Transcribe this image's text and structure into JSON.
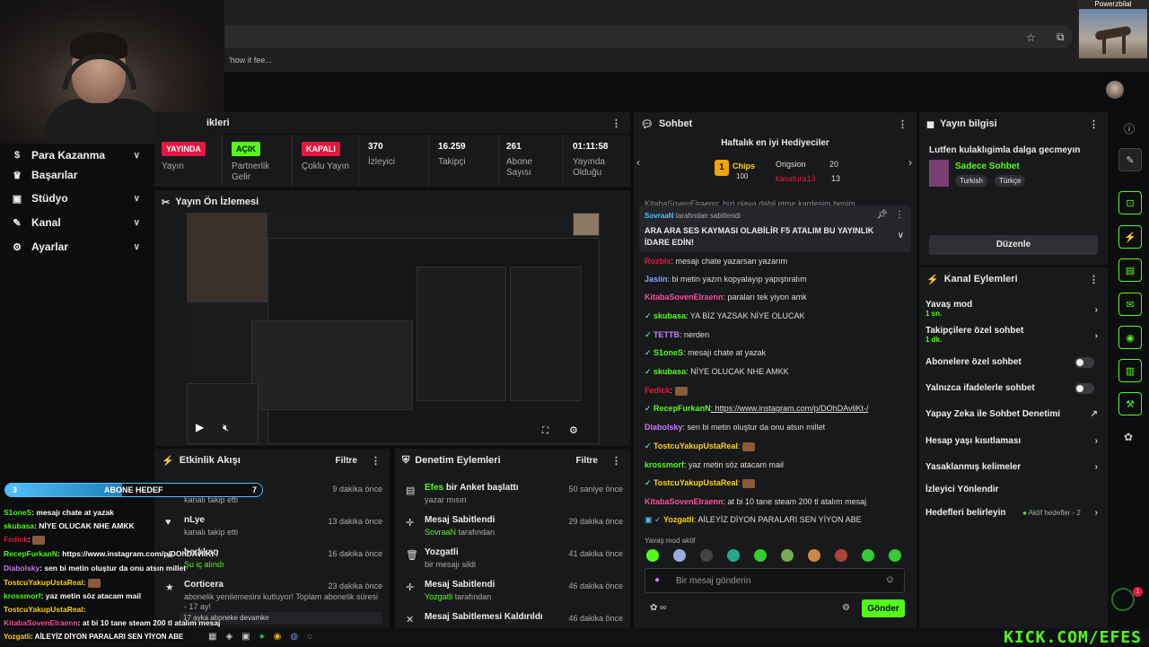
{
  "browser": {
    "bookmark": "'how it fee..."
  },
  "pip": {
    "label": "Powerzbilal"
  },
  "sidenav": [
    {
      "label": "Para Kazanma",
      "icon": "dollar-icon",
      "chev": "∨"
    },
    {
      "label": "Başarılar",
      "icon": "trophy-icon",
      "chev": ""
    },
    {
      "label": "Stüdyo",
      "icon": "studio-icon",
      "chev": "∨"
    },
    {
      "label": "Kanal",
      "icon": "channel-icon",
      "chev": "∨"
    },
    {
      "label": "Ayarlar",
      "icon": "gear-icon",
      "chev": "∨"
    }
  ],
  "stats_header": "ikleri",
  "stats": [
    {
      "value": "YAYINDA",
      "label": "Yayın"
    },
    {
      "value": "AÇIK",
      "label": "Partnerlik Gelir"
    },
    {
      "value": "KAPALI",
      "label": "Çoklu Yayın"
    },
    {
      "value": "370",
      "label": "İzleyici"
    },
    {
      "value": "16.259",
      "label": "Takipçi"
    },
    {
      "value": "261",
      "label": "Abone Sayısı"
    },
    {
      "value": "01:11:58",
      "label": "Yayında Olduğu"
    }
  ],
  "preview": {
    "title": "Yayın Ön İzlemesi"
  },
  "events": {
    "title": "Etkinlik Akışı",
    "filter": "Filtre",
    "items": [
      {
        "name": "alierenmingsaer",
        "desc": "kanalı takip etti",
        "time": "9 dakika önce"
      },
      {
        "name": "nLye",
        "desc": "kanalı takip etti",
        "time": "13 dakika önce"
      },
      {
        "name": "berkkan",
        "desc": "Şu iç alındı",
        "time": "16 dakika önce"
      },
      {
        "name": "Corticera",
        "desc": "abonelik yenilemesini kutluyor! Toplam abonelik süresi - 17 ay!",
        "time": "23 dakika önce"
      },
      {
        "name": "",
        "desc": "17 ayka aboneke devamke",
        "time": ""
      }
    ]
  },
  "mod": {
    "title": "Denetim Eylemleri",
    "filter": "Filtre",
    "items": [
      {
        "title_user": "Efes",
        "title": " bir Anket başlattı",
        "desc": "yazar mısın",
        "time": "50 saniye önce"
      },
      {
        "title_user": "",
        "title": "Mesaj Sabitlendi",
        "desc_user": "SovraaN",
        "desc": " tarafından",
        "time": "29 dakika önce"
      },
      {
        "title_user": "",
        "title": "Yozgatli",
        "desc": "bir mesajı sildi",
        "time": "41 dakika önce"
      },
      {
        "title_user": "",
        "title": "Mesaj Sabitlendi",
        "desc_user": "Yozgatli",
        "desc": " tarafından",
        "time": "46 dakika önce"
      },
      {
        "title_user": "",
        "title": "Mesaj Sabitlemesi Kaldırıldı",
        "desc": "",
        "time": "46 dakika önce"
      }
    ]
  },
  "chat": {
    "title": "Sohbet",
    "gifters_title": "Haftalık en iyi Hediyeciler",
    "gifters": [
      {
        "rank": "1",
        "name": "Chips",
        "count": "100"
      },
      {
        "name": "Origsion",
        "count": "20"
      },
      {
        "name": "kasatura13",
        "count": "13"
      }
    ],
    "partial_line": "KitabaSovenElraenn: bizi olaya dahil etme kardeşim benim",
    "pinned_by": "SovraaN",
    "pinned_by_suffix": "tarafından sabitlendi",
    "pinned_text": "ARA ARA SES KAYMASI OLABİLİR F5 ATALIM BU YAYINLIK İDARE EDİN!",
    "messages": [
      {
        "user": "Rozbis",
        "color": "#e5173f",
        "text": ": mesajı chate yazarsan yazarım"
      },
      {
        "user": "Jasiin",
        "color": "#7fa7ff",
        "text": ": bi metin yazın kopyalayıp yapıştıralım"
      },
      {
        "user": "KitabaSovenElraenn",
        "color": "#ff4d9a",
        "text": ": paraları tek yiyon amk"
      },
      {
        "user": "skubasa",
        "color": "#53fc18",
        "text": ": YA BİZ YAZSAK NİYE OLUCAK"
      },
      {
        "user": "TETTB",
        "color": "#c77dff",
        "text": ": nerden"
      },
      {
        "user": "S1oneS",
        "color": "#53fc18",
        "text": ": mesajı chate at yazak"
      },
      {
        "user": "skubasa",
        "color": "#53fc18",
        "text": ": NİYE OLUCAK NHE AMKK"
      },
      {
        "user": "Fedick",
        "color": "#e5173f",
        "text": ":"
      },
      {
        "user": "RecepFurkanN",
        "color": "#53fc18",
        "text": ": https://www.instagram.com/p/DOhDAvliKt-/"
      },
      {
        "user": "Diabolsky",
        "color": "#c77dff",
        "text": ": sen bi metin oluştur da onu atsın millet"
      },
      {
        "user": "TostcuYakupUstaReal",
        "color": "#ffd400",
        "text": ":"
      },
      {
        "user": "krossmorf",
        "color": "#53fc18",
        "text": ": yaz metin söz atacam mail"
      },
      {
        "user": "TostcuYakupUstaReal",
        "color": "#ffd400",
        "text": ":"
      },
      {
        "user": "KitabaSovenElraenn",
        "color": "#ff4d9a",
        "text": ": at bi 10 tane steam 200 tl atalım mesaj"
      },
      {
        "user": "Yozgatli",
        "color": "#ffd400",
        "text": ": AİLEYİZ DİYON PARALARI SEN YİYON ABE"
      }
    ],
    "slow_mode": "Yavaş mod aktif",
    "input_placeholder": "Bir mesaj gönderin",
    "send": "Gönder"
  },
  "info": {
    "title": "Yayın bilgisi",
    "stream_title": "Lutfen kulaklıgimla dalga gecmeyın",
    "category": "Sadece Sohbet",
    "tags": [
      "Turkish",
      "Türkçe"
    ],
    "edit": "Düzenle"
  },
  "actions": {
    "title": "Kanal Eylemleri",
    "items": [
      {
        "label": "Yavaş mod",
        "sub": "1 sn.",
        "ctrl": "chev"
      },
      {
        "label": "Takipçilere özel sohbet",
        "sub": "1 dk.",
        "ctrl": "chev"
      },
      {
        "label": "Abonelere özel sohbet",
        "sub": "",
        "ctrl": "toggle"
      },
      {
        "label": "Yalnızca ifadelerle sohbet",
        "sub": "",
        "ctrl": "toggle"
      },
      {
        "label": "Yapay Zeka ile Sohbet Denetimi",
        "sub": "",
        "ctrl": "ext"
      },
      {
        "label": "Hesap yaşı kısıtlaması",
        "sub": "",
        "ctrl": "chev"
      },
      {
        "label": "Yasaklanmış kelimeler",
        "sub": "",
        "ctrl": "chev"
      },
      {
        "label": "İzleyici Yönlendir",
        "sub": "",
        "ctrl": ""
      },
      {
        "label": "Hedefleri belirleyin",
        "sub": "",
        "ctrl": "chev",
        "extra": "Aktif hedefler - 2"
      }
    ]
  },
  "overlay": {
    "goal_left": "3",
    "goal_label": "ABONE HEDEF",
    "goal_right": "7",
    "lines": [
      {
        "user": "S1oneS",
        "color": "#53fc18",
        "text": ": mesajı chate at yazak"
      },
      {
        "user": "skubasa",
        "color": "#53fc18",
        "text": ": NİYE OLUCAK NHE AMKK"
      },
      {
        "user": "Fedick",
        "color": "#e5173f",
        "text": ":"
      },
      {
        "user": "RecepFurkanN",
        "color": "#53fc18",
        "text": ": https://www.instagram.com/p/DOhDAvliKt-/"
      },
      {
        "user": "Diabolsky",
        "color": "#c77dff",
        "text": ": sen bi metin oluştur da onu atsın millet"
      },
      {
        "user": "TostcuYakupUstaReal",
        "color": "#ffd400",
        "text": ":"
      },
      {
        "user": "krossmorf",
        "color": "#53fc18",
        "text": ": yaz metin söz atacam mail"
      },
      {
        "user": "TostcuYakupUstaReal",
        "color": "#ffd400",
        "text": ":"
      },
      {
        "user": "KitabaSovenElraenn",
        "color": "#ff4d9a",
        "text": ": at bi 10 tane steam 200 tl atalım mesaj"
      },
      {
        "user": "Yozgatli",
        "color": "#ffd400",
        "text": ": AİLEYİZ DİYON PARALARI SEN YİYON ABE"
      }
    ]
  },
  "brand": {
    "watermark": "KICK.COM/EFES",
    "accent": "#53fc18"
  }
}
